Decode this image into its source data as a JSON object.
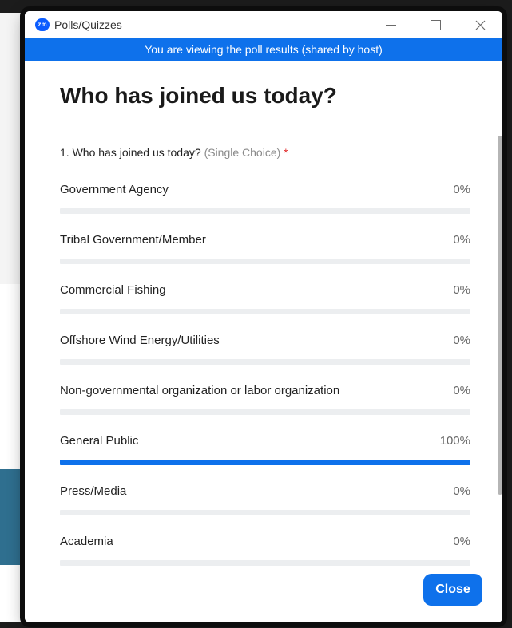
{
  "window": {
    "title": "Polls/Quizzes",
    "logo_text": "zm"
  },
  "banner": {
    "text": "You are viewing the poll results (shared by host)"
  },
  "poll": {
    "title": "Who has joined us today?",
    "question": {
      "number_text": "1. Who has joined us today?",
      "type_text": "(Single Choice)",
      "required_mark": "*"
    },
    "options": [
      {
        "label": "Government Agency",
        "percent_text": "0%",
        "percent": 0
      },
      {
        "label": "Tribal Government/Member",
        "percent_text": "0%",
        "percent": 0
      },
      {
        "label": "Commercial Fishing",
        "percent_text": "0%",
        "percent": 0
      },
      {
        "label": "Offshore Wind Energy/Utilities",
        "percent_text": "0%",
        "percent": 0
      },
      {
        "label": "Non-governmental organization or labor organization",
        "percent_text": "0%",
        "percent": 0
      },
      {
        "label": "General Public",
        "percent_text": "100%",
        "percent": 100
      },
      {
        "label": "Press/Media",
        "percent_text": "0%",
        "percent": 0
      },
      {
        "label": "Academia",
        "percent_text": "0%",
        "percent": 0
      }
    ]
  },
  "footer": {
    "close_label": "Close"
  },
  "icons": {
    "minimize": "minimize-icon",
    "maximize": "maximize-icon",
    "close": "close-icon"
  },
  "colors": {
    "accent": "#0e71eb",
    "bar_track": "#eceef0"
  }
}
